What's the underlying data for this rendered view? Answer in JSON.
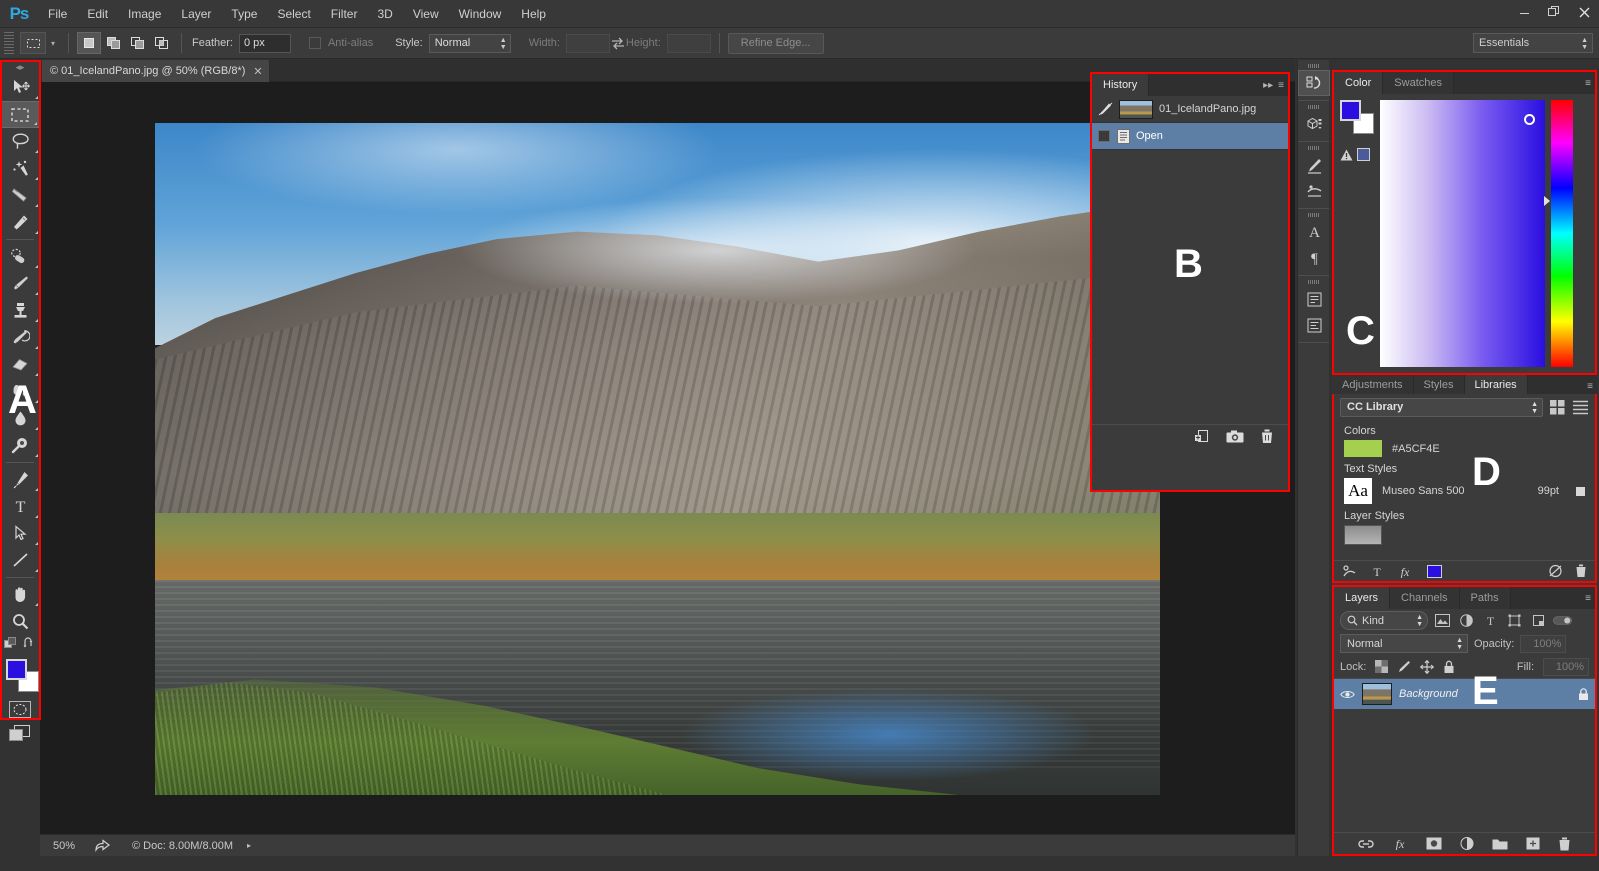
{
  "app": {
    "logo": "Ps",
    "workspace": "Essentials"
  },
  "menubar": {
    "items": [
      {
        "label": "File"
      },
      {
        "label": "Edit"
      },
      {
        "label": "Image"
      },
      {
        "label": "Layer"
      },
      {
        "label": "Type"
      },
      {
        "label": "Select"
      },
      {
        "label": "Filter"
      },
      {
        "label": "3D"
      },
      {
        "label": "View"
      },
      {
        "label": "Window"
      },
      {
        "label": "Help"
      }
    ]
  },
  "window_controls": {
    "minimize": "—",
    "maximize": "❐",
    "close": "✕"
  },
  "options_bar": {
    "feather_label": "Feather:",
    "feather_value": "0 px",
    "antialias_label": "Anti-alias",
    "style_label": "Style:",
    "style_value": "Normal",
    "width_label": "Width:",
    "width_value": "",
    "height_label": "Height:",
    "height_value": "",
    "refine_edge_label": "Refine Edge..."
  },
  "toolbar": {
    "tools": [
      {
        "name": "move-tool",
        "selected": false
      },
      {
        "name": "rectangular-marquee-tool",
        "selected": true
      },
      {
        "name": "lasso-tool",
        "selected": false
      },
      {
        "name": "magic-wand-tool",
        "selected": false
      },
      {
        "name": "crop-tool",
        "selected": false
      },
      {
        "name": "eyedropper-tool",
        "selected": false
      },
      {
        "name": "healing-brush-tool",
        "selected": false
      },
      {
        "name": "brush-tool",
        "selected": false
      },
      {
        "name": "clone-stamp-tool",
        "selected": false
      },
      {
        "name": "history-brush-tool",
        "selected": false
      },
      {
        "name": "eraser-tool",
        "selected": false
      },
      {
        "name": "gradient-tool",
        "selected": false
      },
      {
        "name": "blur-tool",
        "selected": false
      },
      {
        "name": "dodge-tool",
        "selected": false
      },
      {
        "name": "pen-tool",
        "selected": false
      },
      {
        "name": "type-tool",
        "selected": false
      },
      {
        "name": "path-selection-tool",
        "selected": false
      },
      {
        "name": "line-tool",
        "selected": false
      },
      {
        "name": "hand-tool",
        "selected": false
      },
      {
        "name": "zoom-tool",
        "selected": false
      }
    ],
    "foreground_color": "#2a0fe0",
    "background_color": "#ffffff"
  },
  "document": {
    "tab_title": "© 01_IcelandPano.jpg @ 50% (RGB/8*)",
    "close_glyph": "✕"
  },
  "status_bar": {
    "zoom": "50%",
    "doc_info": "© Doc: 8.00M/8.00M",
    "arrow": "▸"
  },
  "history_panel": {
    "tab": "History",
    "overlay_letter": "B",
    "rows": [
      {
        "label": "01_IcelandPano.jpg",
        "type": "snapshot",
        "selected": false
      },
      {
        "label": "Open",
        "type": "state",
        "selected": true
      }
    ],
    "footer_icons": [
      {
        "name": "new-document-from-state-icon"
      },
      {
        "name": "new-snapshot-camera-icon"
      },
      {
        "name": "delete-trash-icon"
      }
    ]
  },
  "color_panel": {
    "overlay_letter": "C",
    "tabs": [
      {
        "label": "Color",
        "active": true
      },
      {
        "label": "Swatches",
        "active": false
      }
    ],
    "foreground_color": "#2a0fe0",
    "background_color": "#ffffff",
    "out_of_gamut_color": "#4a5a9a"
  },
  "libraries_panel": {
    "overlay_letter": "D",
    "tabs": [
      {
        "label": "Adjustments",
        "active": false
      },
      {
        "label": "Styles",
        "active": false
      },
      {
        "label": "Libraries",
        "active": true
      }
    ],
    "library_select": "CC Library",
    "sections": {
      "colors_label": "Colors",
      "color_value": "#A5CF4E",
      "color_hex": "#A5CF4E",
      "text_styles_label": "Text Styles",
      "text_style_name": "Museo Sans 500",
      "text_style_size": "99pt",
      "layer_styles_label": "Layer Styles"
    },
    "footer_icons": [
      {
        "name": "add-graphic-icon"
      },
      {
        "name": "add-text-style-icon"
      },
      {
        "name": "add-layer-style-icon"
      },
      {
        "name": "add-color-icon"
      },
      {
        "name": "sync-icon"
      },
      {
        "name": "delete-icon"
      }
    ]
  },
  "layers_panel": {
    "overlay_letter": "E",
    "tabs": [
      {
        "label": "Layers",
        "active": true
      },
      {
        "label": "Channels",
        "active": false
      },
      {
        "label": "Paths",
        "active": false
      }
    ],
    "filter_kind": "Kind",
    "blend_mode": "Normal",
    "opacity_label": "Opacity:",
    "opacity_value": "100%",
    "lock_label": "Lock:",
    "fill_label": "Fill:",
    "fill_value": "100%",
    "layers": [
      {
        "name": "Background",
        "locked": true,
        "visible": true
      }
    ],
    "footer_icons": [
      {
        "name": "link-layers-icon"
      },
      {
        "name": "layer-style-fx-icon"
      },
      {
        "name": "add-layer-mask-icon"
      },
      {
        "name": "adjustment-layer-icon"
      },
      {
        "name": "new-group-icon"
      },
      {
        "name": "new-layer-icon"
      },
      {
        "name": "delete-layer-icon"
      }
    ]
  },
  "icon_dock": {
    "groups": [
      {
        "icons": [
          {
            "name": "history-dock-icon",
            "active": true
          }
        ]
      },
      {
        "icons": [
          {
            "name": "3d-dock-icon",
            "active": false
          }
        ]
      },
      {
        "icons": [
          {
            "name": "brush-preset-dock-icon",
            "active": false
          },
          {
            "name": "brush-settings-dock-icon",
            "active": false
          }
        ]
      },
      {
        "icons": [
          {
            "name": "character-dock-icon",
            "active": false
          },
          {
            "name": "paragraph-dock-icon",
            "active": false
          }
        ]
      },
      {
        "icons": [
          {
            "name": "character-styles-dock-icon",
            "active": false
          },
          {
            "name": "paragraph-styles-dock-icon",
            "active": false
          }
        ]
      }
    ]
  },
  "annotations": {
    "toolbar_letter": "A",
    "highlight_color": "#ff0000"
  }
}
